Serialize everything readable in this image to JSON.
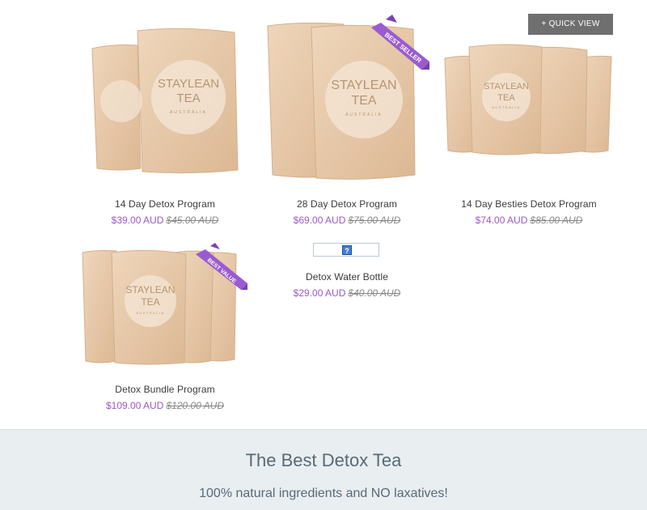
{
  "quick_view_label": "+ QUICK VIEW",
  "products": [
    {
      "name": "14 Day Detox Program",
      "price": "$39.00 AUD",
      "old_price": "$45.00 AUD",
      "badge": ""
    },
    {
      "name": "28 Day Detox Program",
      "price": "$69.00 AUD",
      "old_price": "$75.00 AUD",
      "badge": "BEST SELLER"
    },
    {
      "name": "14 Day Besties Detox Program",
      "price": "$74.00 AUD",
      "old_price": "$85.00 AUD",
      "badge": ""
    },
    {
      "name": "Detox Bundle Program",
      "price": "$109.00 AUD",
      "old_price": "$120.00 AUD",
      "badge": "BEST VALUE"
    },
    {
      "name": "Detox Water Bottle",
      "price": "$29.00 AUD",
      "old_price": "$40.00 AUD",
      "badge": "",
      "image_missing_glyph": "?"
    }
  ],
  "bag_brand": {
    "line1": "STAYLEAN",
    "line2": "TEA",
    "line3": "AUSTRALIA"
  },
  "banner": {
    "heading": "The Best Detox Tea",
    "subheading": "100% natural ingredients and NO laxatives!"
  },
  "colors": {
    "price": "#9b59c8",
    "ribbon": "#9a5bd0",
    "banner_bg": "#e9eef1",
    "bag": "#e7c9a8"
  }
}
